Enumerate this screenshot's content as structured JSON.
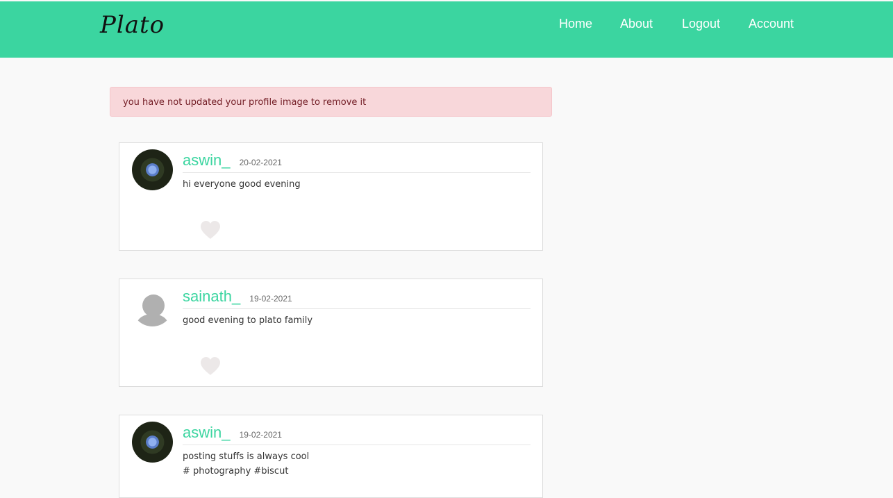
{
  "nav": {
    "brand": "Plato",
    "links": [
      "Home",
      "About",
      "Logout",
      "Account"
    ]
  },
  "alert": {
    "message": "you have not updated your profile image to remove it"
  },
  "posts": [
    {
      "username": "aswin_",
      "date": "20-02-2021",
      "text_lines": [
        "hi everyone good evening"
      ],
      "avatar": "profile-photo"
    },
    {
      "username": "sainath_",
      "date": "19-02-2021",
      "text_lines": [
        "good evening to plato family"
      ],
      "avatar": "default-user-icon"
    },
    {
      "username": "aswin_",
      "date": "19-02-2021",
      "text_lines": [
        "posting stuffs is always cool",
        "# photography #biscut"
      ],
      "avatar": "profile-photo"
    }
  ],
  "colors": {
    "accent": "#3bd5a0",
    "alert_bg": "#f8d7da",
    "alert_text": "#721c24",
    "heart": "#ece8e8"
  }
}
